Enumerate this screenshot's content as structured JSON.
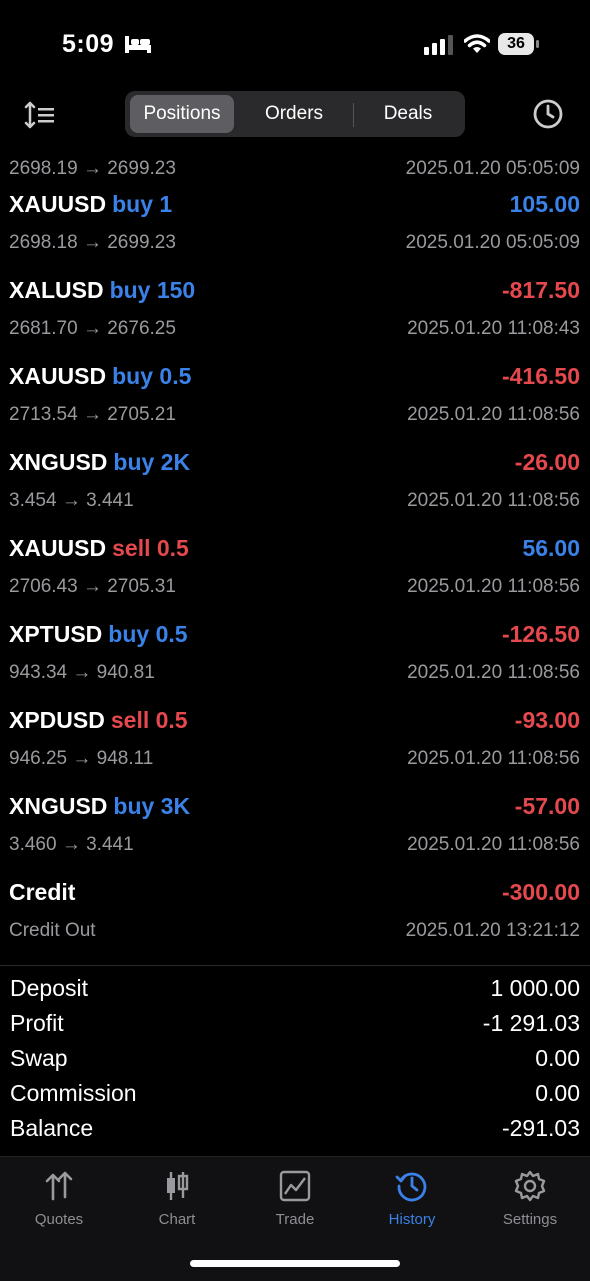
{
  "status_bar": {
    "time": "5:09",
    "battery": "36"
  },
  "header": {
    "tabs": [
      {
        "label": "Positions",
        "active": true
      },
      {
        "label": "Orders",
        "active": false
      },
      {
        "label": "Deals",
        "active": false
      }
    ]
  },
  "deals": {
    "partial": {
      "prices": "2698.19 → 2699.23",
      "time": "2025.01.20 05:05:09"
    },
    "rows": [
      {
        "symbol": "XAUUSD",
        "direction": "buy 1",
        "profit": "105.00",
        "prices": "2698.18 → 2699.23",
        "time": "2025.01.20 05:05:09"
      },
      {
        "symbol": "XALUSD",
        "direction": "buy 150",
        "profit": "-817.50",
        "prices": "2681.70 → 2676.25",
        "time": "2025.01.20 11:08:43"
      },
      {
        "symbol": "XAUUSD",
        "direction": "buy 0.5",
        "profit": "-416.50",
        "prices": "2713.54 → 2705.21",
        "time": "2025.01.20 11:08:56"
      },
      {
        "symbol": "XNGUSD",
        "direction": "buy 2K",
        "profit": "-26.00",
        "prices": "3.454 → 3.441",
        "time": "2025.01.20 11:08:56"
      },
      {
        "symbol": "XAUUSD",
        "direction": "sell 0.5",
        "profit": "56.00",
        "prices": "2706.43 → 2705.31",
        "time": "2025.01.20 11:08:56"
      },
      {
        "symbol": "XPTUSD",
        "direction": "buy 0.5",
        "profit": "-126.50",
        "prices": "943.34 → 940.81",
        "time": "2025.01.20 11:08:56"
      },
      {
        "symbol": "XPDUSD",
        "direction": "sell 0.5",
        "profit": "-93.00",
        "prices": "946.25 → 948.11",
        "time": "2025.01.20 11:08:56"
      },
      {
        "symbol": "XNGUSD",
        "direction": "buy 3K",
        "profit": "-57.00",
        "prices": "3.460 → 3.441",
        "time": "2025.01.20 11:08:56"
      },
      {
        "symbol": "Credit",
        "direction": "",
        "profit": "-300.00",
        "prices": "Credit Out",
        "time": "2025.01.20 13:21:12"
      }
    ]
  },
  "summary": [
    {
      "label": "Deposit",
      "value": "1 000.00"
    },
    {
      "label": "Profit",
      "value": "-1 291.03"
    },
    {
      "label": "Swap",
      "value": "0.00"
    },
    {
      "label": "Commission",
      "value": "0.00"
    },
    {
      "label": "Balance",
      "value": "-291.03"
    }
  ],
  "tab_bar": [
    {
      "label": "Quotes",
      "icon": "quotes-icon",
      "active": false
    },
    {
      "label": "Chart",
      "icon": "chart-icon",
      "active": false
    },
    {
      "label": "Trade",
      "icon": "trade-icon",
      "active": false
    },
    {
      "label": "History",
      "icon": "history-icon",
      "active": true
    },
    {
      "label": "Settings",
      "icon": "settings-icon",
      "active": false
    }
  ],
  "colors": {
    "buy": "#3a82e8",
    "sell": "#e5484d",
    "positive": "#3a82e8",
    "negative": "#e5484d",
    "active_tab": "#3a82e8"
  }
}
